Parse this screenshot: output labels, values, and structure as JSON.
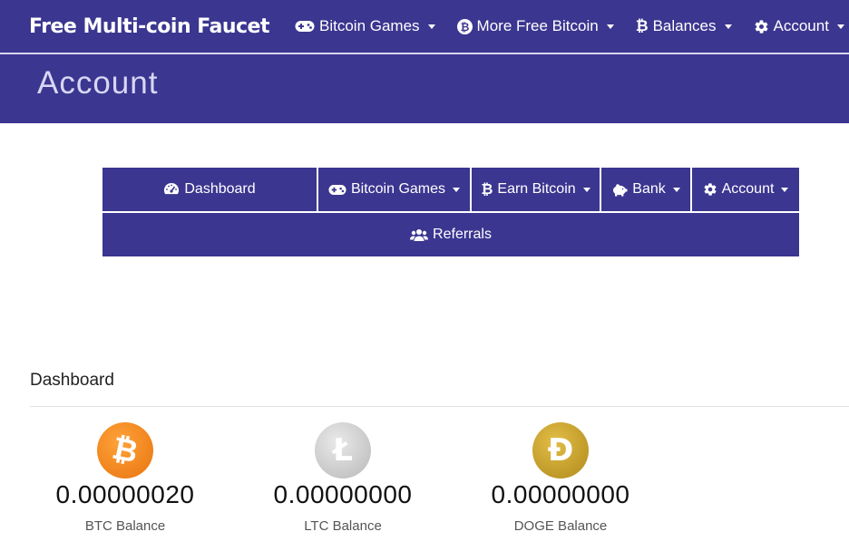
{
  "navbar": {
    "brand": "Free Multi-coin Faucet",
    "items": [
      {
        "label": "Bitcoin Games",
        "icon": "gamepad-icon"
      },
      {
        "label": "More Free Bitcoin",
        "icon": "bitcoin-circle-icon"
      },
      {
        "label": "Balances",
        "icon": "bitcoin-icon"
      },
      {
        "label": "Account",
        "icon": "gear-icon"
      }
    ]
  },
  "page": {
    "title": "Account"
  },
  "submenu": {
    "row1": [
      {
        "label": "Dashboard",
        "icon": "speedometer-icon"
      },
      {
        "label": "Bitcoin Games",
        "icon": "gamepad-icon"
      },
      {
        "label": "Earn Bitcoin",
        "icon": "bitcoin-icon"
      },
      {
        "label": "Bank",
        "icon": "piggy-bank-icon"
      },
      {
        "label": "Account",
        "icon": "gear-icon"
      }
    ],
    "row2": [
      {
        "label": "Referrals",
        "icon": "users-icon"
      }
    ]
  },
  "dashboard": {
    "title": "Dashboard",
    "balances": [
      {
        "symbol": "₿",
        "amount": "0.00000020",
        "label": "BTC Balance",
        "color": "#f7931a"
      },
      {
        "symbol": "Ł",
        "amount": "0.00000000",
        "label": "LTC Balance",
        "color": "#bebebe"
      },
      {
        "symbol": "Đ",
        "amount": "0.00000000",
        "label": "DOGE Balance",
        "color": "#c2a633"
      }
    ]
  },
  "colors": {
    "primary": "#3b3690",
    "header_text": "#d8d6f4"
  }
}
